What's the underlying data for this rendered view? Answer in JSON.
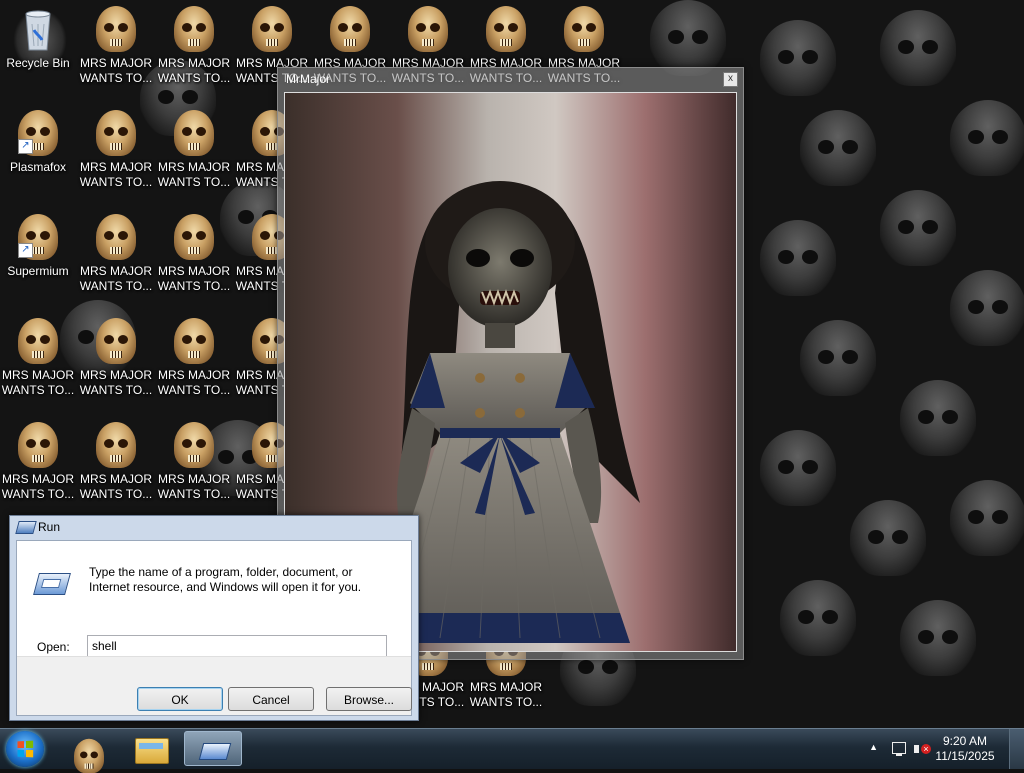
{
  "desktop": {
    "icons": [
      {
        "label": "Recycle Bin",
        "icon": "recycle-bin-icon"
      },
      {
        "label": "Plasmafox",
        "icon": "skull-icon",
        "shortcut": true
      },
      {
        "label": "Supermium",
        "icon": "skull-icon",
        "shortcut": true
      },
      {
        "label": "MRS MAJOR WANTS TO...",
        "icon": "skull-icon"
      }
    ],
    "skull_label_line1": "MRS MAJOR",
    "skull_label_line2": "WANTS TO..."
  },
  "mrmajor_window": {
    "title": "MrMajor",
    "close_glyph": "x"
  },
  "run_dialog": {
    "title": "Run",
    "description": "Type the name of a program, folder, document, or Internet resource, and Windows will open it for you.",
    "open_label": "Open:",
    "open_value": "shell",
    "ok_label": "OK",
    "cancel_label": "Cancel",
    "browse_label": "Browse..."
  },
  "taskbar": {
    "time": "9:20 AM",
    "date": "11/15/2025"
  }
}
